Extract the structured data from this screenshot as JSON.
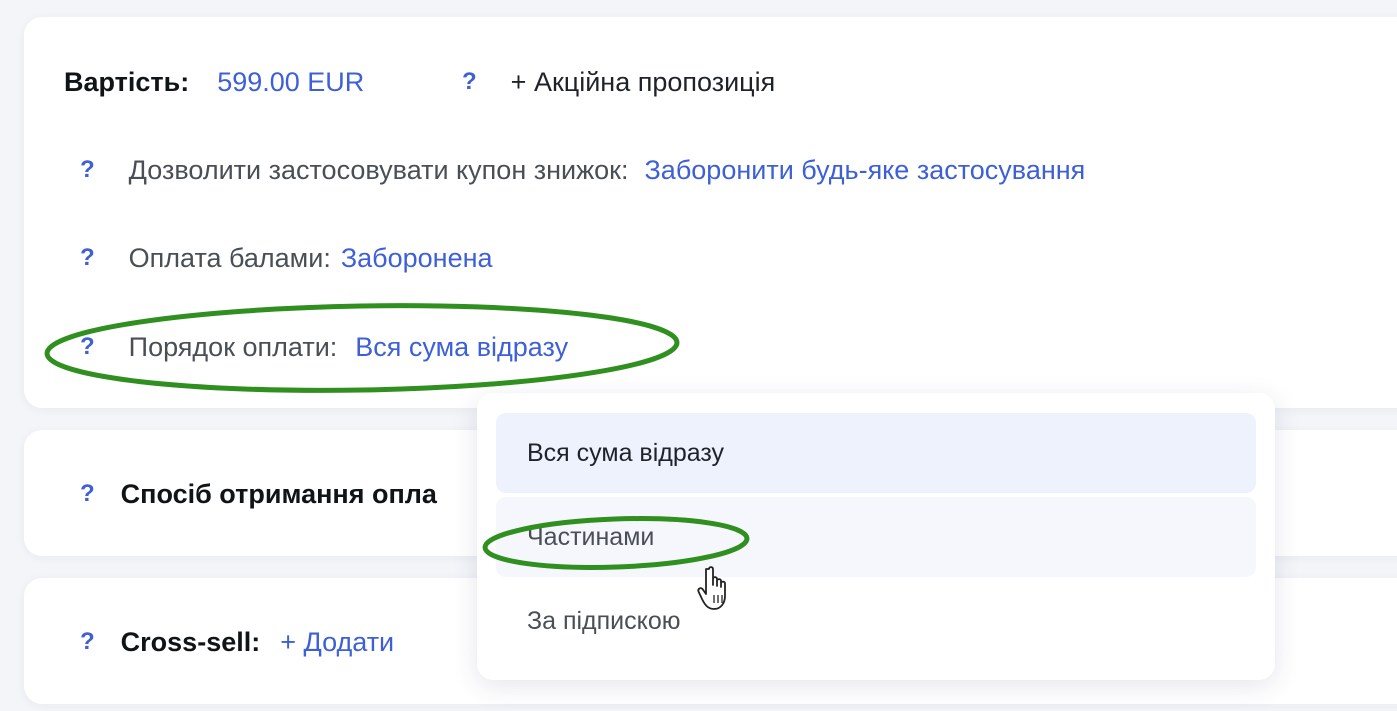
{
  "price": {
    "label": "Вартість:",
    "value": "599.00 EUR",
    "help_icon": "question-icon",
    "promo_link": "+ Акційна пропозиція"
  },
  "coupon": {
    "help": "?",
    "label": "Дозволити застосовувати купон знижок:",
    "value": "Заборонити будь-яке застосування"
  },
  "points": {
    "help": "?",
    "label": "Оплата балами:",
    "value": "Заборонена"
  },
  "payment_order": {
    "help": "?",
    "label": "Порядок оплати:",
    "value": "Вся сума відразу"
  },
  "receipt": {
    "help": "?",
    "label": "Спосіб отримання опла"
  },
  "cross_sell": {
    "help": "?",
    "label": "Cross-sell:",
    "add_link": "+ Додати"
  },
  "dropdown": {
    "options": [
      "Вся сума відразу",
      "Частинами",
      "За підпискою"
    ],
    "selected": "Вся сума відразу",
    "hovered": "Частинами"
  },
  "annotations": {
    "color": "#2f8f1f"
  },
  "colors": {
    "accent": "#3d5fd8",
    "background": "#f3f5f9"
  }
}
